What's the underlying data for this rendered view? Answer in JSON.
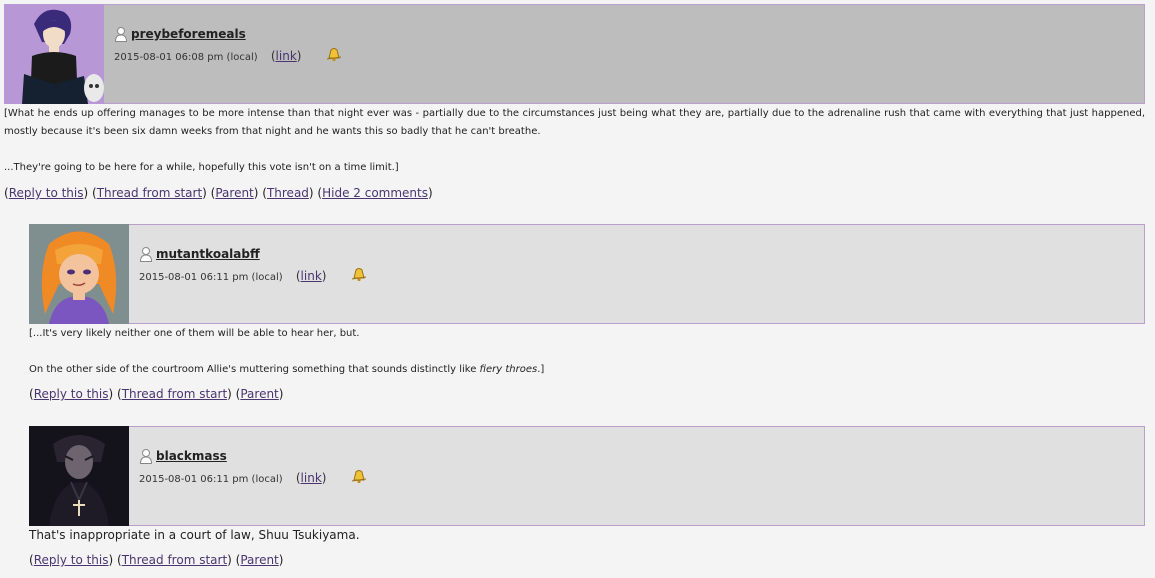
{
  "comments": [
    {
      "username": "preybeforemeals",
      "datetime": "2015-08-01 06:08 pm (local)",
      "link_label": "link",
      "body": [
        "[What he ends up offering manages to be more intense than that night ever was - partially due to the circumstances just being what they are, partially due to the adrenaline rush that came with everything that just happened, mostly because it's been six damn weeks from that night and he wants this so badly that he can't breathe.",
        "...They're going to be here for a while, hopefully this vote isn't on a time limit.]"
      ],
      "actions": [
        "Reply to this",
        "Thread from start",
        "Parent",
        "Thread",
        "Hide 2 comments"
      ],
      "header_color": "#bdbdbd"
    },
    {
      "username": "mutantkoalabff",
      "datetime": "2015-08-01 06:11 pm (local)",
      "link_label": "link",
      "body_line1": "[...It's very likely neither one of them will be able to hear her, but.",
      "body_line2_prefix": "On the other side of the courtroom Allie's muttering something that sounds distinctly like ",
      "body_line2_italic": "fiery throes",
      "body_line2_suffix": ".]",
      "actions": [
        "Reply to this",
        "Thread from start",
        "Parent"
      ],
      "header_color": "#e0e0e0"
    },
    {
      "username": "blackmass",
      "datetime": "2015-08-01 06:11 pm (local)",
      "link_label": "link",
      "body": "That's inappropriate in a court of law, Shuu Tsukiyama.",
      "actions": [
        "Reply to this",
        "Thread from start",
        "Parent"
      ],
      "header_color": "#e0e0e0"
    }
  ]
}
